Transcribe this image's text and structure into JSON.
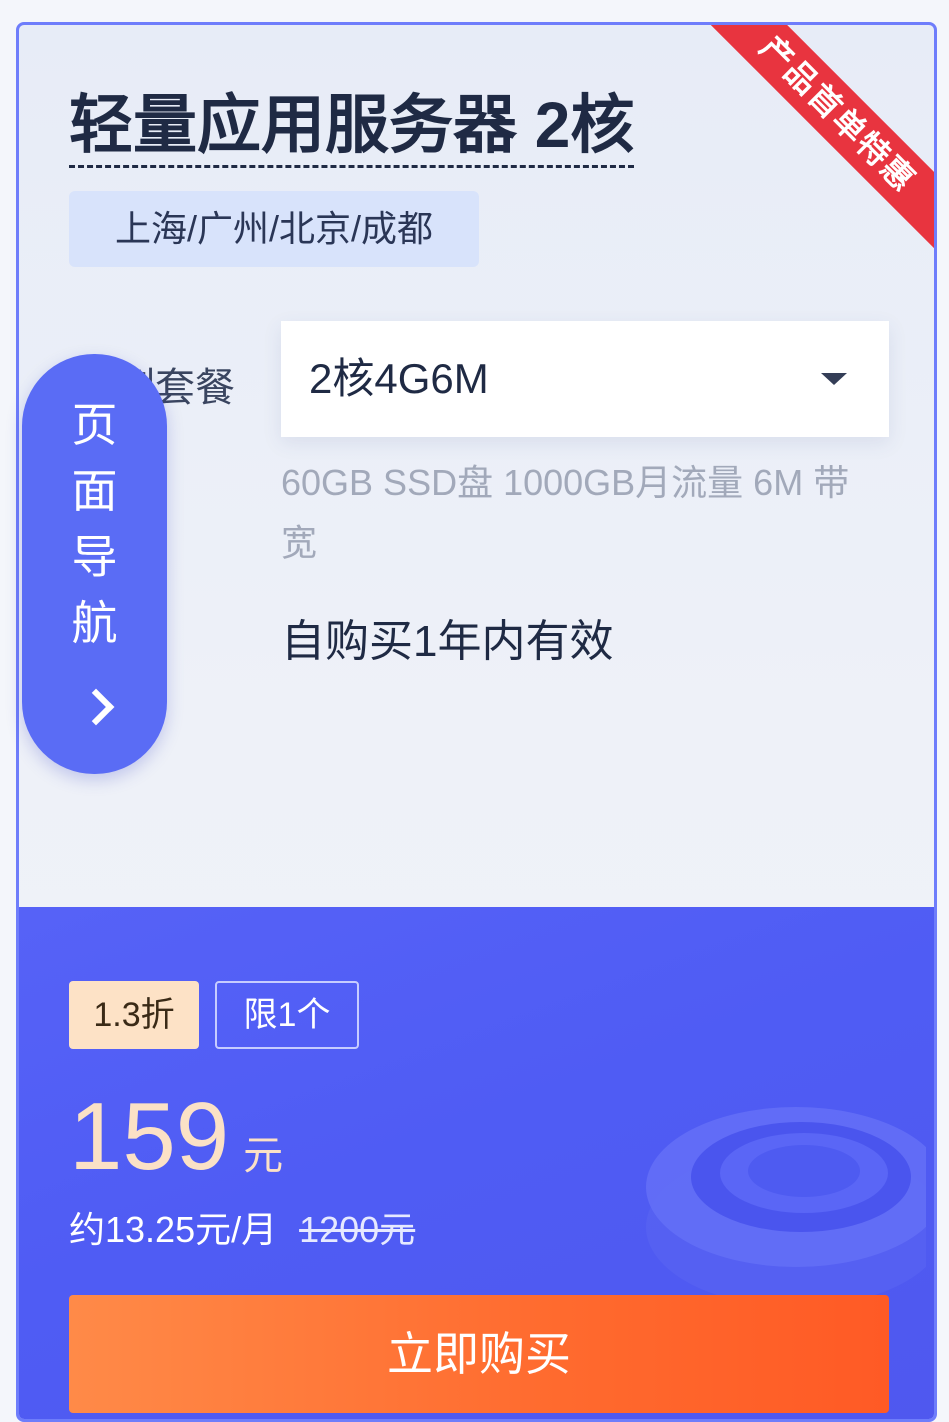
{
  "ribbon": {
    "label": "产品首单特惠"
  },
  "product": {
    "title": "轻量应用服务器 2核",
    "regions": "上海/广州/北京/成都"
  },
  "package": {
    "label": "实例套餐",
    "selected": "2核4G6M",
    "spec": "60GB SSD盘 1000GB月流量 6M 带宽",
    "validity": "自购买1年内有效"
  },
  "nav": {
    "label": "页面导航",
    "icon": "chevron-right-icon"
  },
  "pricing": {
    "discount_badge": "1.3折",
    "limit_badge": "限1个",
    "price": "159",
    "unit": "元",
    "monthly": "约13.25元/月",
    "original": "1200元"
  },
  "cta": {
    "label": "立即购买"
  },
  "colors": {
    "accent": "#5a6cf5",
    "ribbon": "#e8343f",
    "cta": "#ff6a2e",
    "price": "#fbe1c6"
  }
}
